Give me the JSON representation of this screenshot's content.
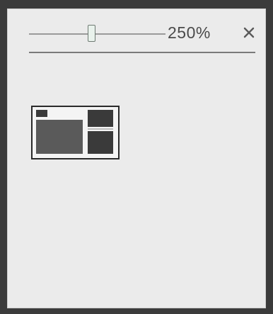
{
  "zoom": {
    "value_label": "250%",
    "slider_level": 0.46
  },
  "icons": {
    "close": "close-icon"
  },
  "colors": {
    "panel_background": "#ebebeb",
    "window_border": "#3b3b3b",
    "slider_thumb_border": "#6e7a72"
  }
}
